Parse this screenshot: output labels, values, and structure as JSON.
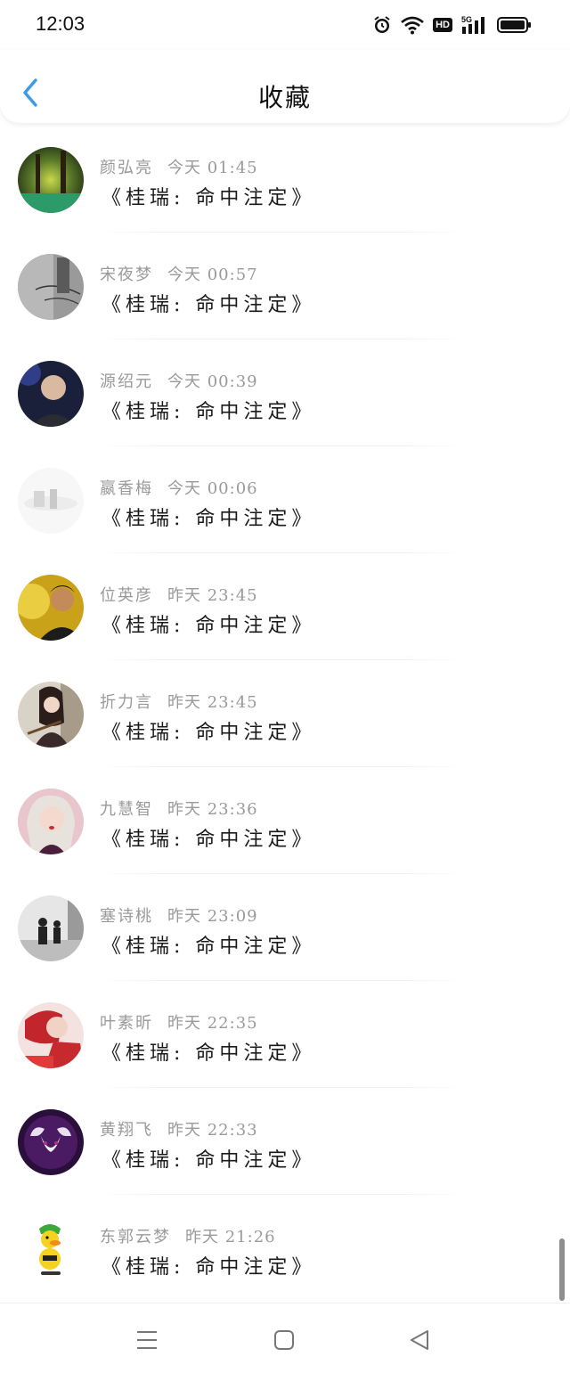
{
  "status_bar": {
    "time": "12:03",
    "icons": [
      "alarm-icon",
      "wifi-icon",
      "hd-badge",
      "5g-signal-icon",
      "battery-icon"
    ],
    "hd_label": "HD",
    "net_label": "5G"
  },
  "header": {
    "title": "收藏",
    "back_icon": "chevron-left-icon",
    "accent_color": "#3a9ae8"
  },
  "favorites": [
    {
      "name": "颜弘亮",
      "time": "今天 01:45",
      "title": "《桂瑞: 命中注定》",
      "avatar": "forest-scene"
    },
    {
      "name": "宋夜梦",
      "time": "今天 00:57",
      "title": "《桂瑞: 命中注定》",
      "avatar": "grey-handwriting"
    },
    {
      "name": "源绍元",
      "time": "今天 00:39",
      "title": "《桂瑞: 命中注定》",
      "avatar": "portrait-dark-blue"
    },
    {
      "name": "嬴香梅",
      "time": "今天 00:06",
      "title": "《桂瑞: 命中注定》",
      "avatar": "faded-white"
    },
    {
      "name": "位英彦",
      "time": "昨天 23:45",
      "title": "《桂瑞: 命中注定》",
      "avatar": "yellow-portrait"
    },
    {
      "name": "折力言",
      "time": "昨天 23:45",
      "title": "《桂瑞: 命中注定》",
      "avatar": "anime-character"
    },
    {
      "name": "九慧智",
      "time": "昨天 23:36",
      "title": "《桂瑞: 命中注定》",
      "avatar": "girl-portrait"
    },
    {
      "name": "塞诗桃",
      "time": "昨天 23:09",
      "title": "《桂瑞: 命中注定》",
      "avatar": "couple-walking"
    },
    {
      "name": "叶素昕",
      "time": "昨天 22:35",
      "title": "《桂瑞: 命中注定》",
      "avatar": "red-portrait"
    },
    {
      "name": "黄翔飞",
      "time": "昨天 22:33",
      "title": "《桂瑞: 命中注定》",
      "avatar": "aries-emblem"
    },
    {
      "name": "东郭云梦",
      "time": "昨天 21:26",
      "title": "《桂瑞: 命中注定》",
      "avatar": "cartoon-duck"
    }
  ],
  "nav_bar": {
    "buttons": [
      "menu-icon",
      "home-icon",
      "back-triangle-icon"
    ]
  }
}
